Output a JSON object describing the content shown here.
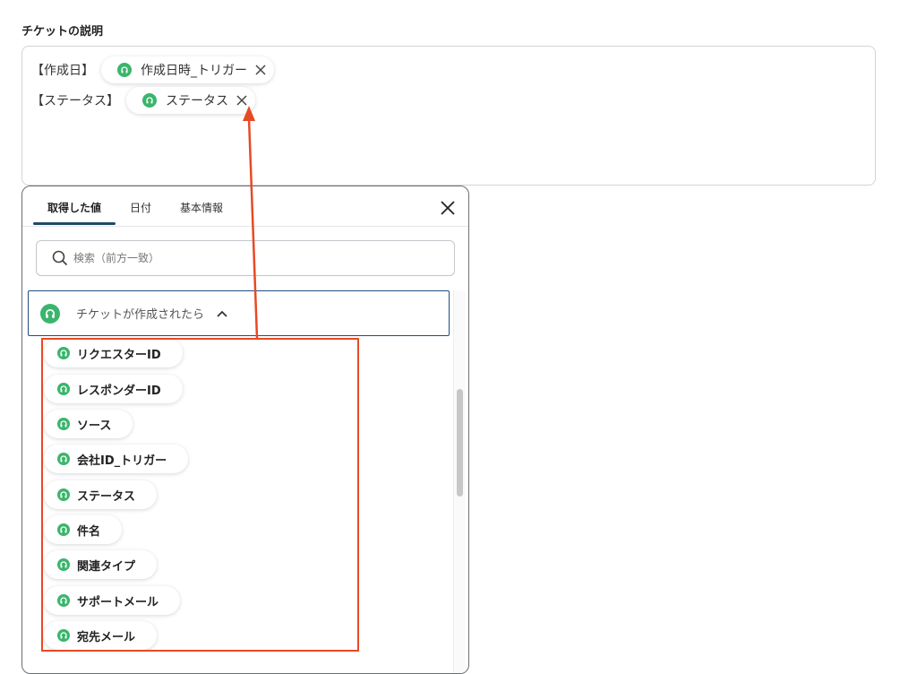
{
  "field": {
    "label": "チケットの説明"
  },
  "editor": {
    "lines": [
      {
        "prefix": "【作成日】",
        "token": "作成日時_トリガー"
      },
      {
        "prefix": "【ステータス】",
        "token": "ステータス"
      }
    ]
  },
  "panel": {
    "tabs": [
      "取得した値",
      "日付",
      "基本情報"
    ],
    "search_placeholder": "検索（前方一致）",
    "group_title": "チケットが作成されたら",
    "items": [
      "リクエスターID",
      "レスポンダーID",
      "ソース",
      "会社ID_トリガー",
      "ステータス",
      "件名",
      "関連タイプ",
      "サポートメール",
      "宛先メール"
    ]
  },
  "colors": {
    "accent_green": "#3bb56c",
    "tab_underline": "#1c4b66",
    "group_border": "#1f4d80",
    "annotation_red": "#e64a25"
  }
}
